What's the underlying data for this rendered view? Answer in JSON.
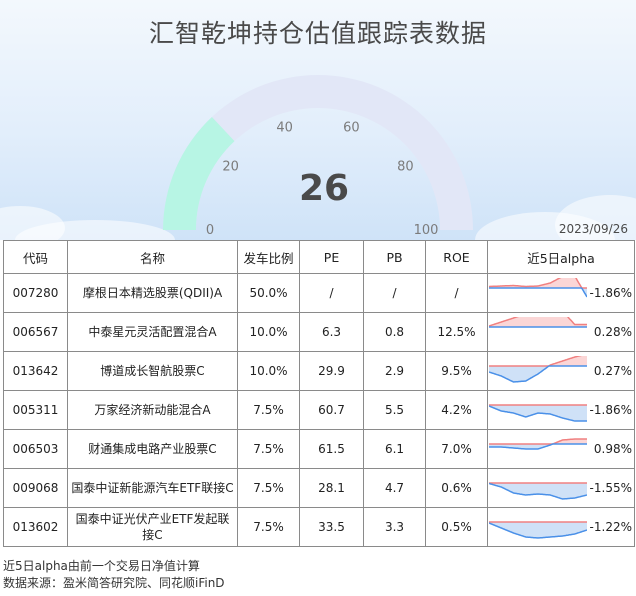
{
  "title": "汇智乾坤持仓估值跟踪表数据",
  "date": "2023/09/26",
  "colors": {
    "gauge_fill": "#b7f5e4",
    "gauge_track": "#e2e7f7",
    "positive": "#f08080",
    "negative": "#4a90e8"
  },
  "gauge": {
    "value": "26",
    "min": 0,
    "max": 100,
    "ticks": [
      "0",
      "20",
      "40",
      "60",
      "80",
      "100"
    ]
  },
  "table": {
    "headers": [
      "代码",
      "名称",
      "发车比例",
      "PE",
      "PB",
      "ROE",
      "近5日alpha"
    ],
    "rows": [
      {
        "code": "007280",
        "name": "摩根日本精选股票(QDII)A",
        "ratio": "50.0%",
        "pe": "/",
        "pb": "/",
        "roe": "/",
        "alpha": "-1.86%",
        "spark": [
          0.15,
          0.2,
          0.25,
          0.15,
          0.2,
          0.5,
          1.15,
          1.2,
          -0.9
        ]
      },
      {
        "code": "006567",
        "name": "中泰星元灵活配置混合A",
        "ratio": "10.0%",
        "pe": "6.3",
        "pb": "0.8",
        "roe": "12.5%",
        "alpha": "0.28%",
        "spark": [
          0.1,
          0.5,
          0.9,
          1.3,
          1.55,
          1.9,
          1.6,
          0.25,
          0.25
        ]
      },
      {
        "code": "013642",
        "name": "博道成长智航股票C",
        "ratio": "10.0%",
        "pe": "29.9",
        "pb": "2.9",
        "roe": "9.5%",
        "alpha": "0.27%",
        "spark": [
          -0.6,
          -1.0,
          -1.6,
          -1.5,
          -0.8,
          0.1,
          0.5,
          0.9,
          1.2
        ]
      },
      {
        "code": "005311",
        "name": "万家经济新动能混合A",
        "ratio": "7.5%",
        "pe": "60.7",
        "pb": "5.5",
        "roe": "4.2%",
        "alpha": "-1.86%",
        "spark": [
          -0.1,
          -0.6,
          -0.8,
          -1.2,
          -0.8,
          -0.9,
          -1.3,
          -1.6,
          -1.6
        ]
      },
      {
        "code": "006503",
        "name": "财通集成电路产业股票C",
        "ratio": "7.5%",
        "pe": "61.5",
        "pb": "6.1",
        "roe": "7.0%",
        "alpha": "0.98%",
        "spark": [
          -0.3,
          -0.3,
          -0.4,
          -0.5,
          -0.5,
          -0.1,
          0.4,
          0.5,
          0.5
        ]
      },
      {
        "code": "009068",
        "name": "国泰中证新能源汽车ETF联接C",
        "ratio": "7.5%",
        "pe": "28.1",
        "pb": "4.7",
        "roe": "0.6%",
        "alpha": "-1.55%",
        "spark": [
          -0.05,
          -0.4,
          -1.0,
          -1.2,
          -1.1,
          -1.2,
          -1.6,
          -1.5,
          -1.2
        ]
      },
      {
        "code": "013602",
        "name": "国泰中证光伏产业ETF发起联接C",
        "ratio": "7.5%",
        "pe": "33.5",
        "pb": "3.3",
        "roe": "0.5%",
        "alpha": "-1.22%",
        "spark": [
          -0.1,
          -0.6,
          -1.1,
          -1.5,
          -1.6,
          -1.5,
          -1.4,
          -1.2,
          -0.8
        ]
      }
    ]
  },
  "notes": [
    "近5日alpha由前一个交易日净值计算",
    "数据来源：盈米简答研究院、同花顺iFinD"
  ],
  "chart_data": [
    {
      "type": "gauge",
      "value": 26,
      "range": [
        0,
        100
      ],
      "tick_labels": [
        "0",
        "20",
        "40",
        "60",
        "80",
        "100"
      ]
    },
    {
      "type": "area",
      "title": "近5日alpha",
      "series": [
        {
          "name": "007280",
          "values": [
            0.15,
            0.2,
            0.25,
            0.15,
            0.2,
            0.5,
            1.15,
            1.2,
            -0.9
          ]
        },
        {
          "name": "006567",
          "values": [
            0.1,
            0.5,
            0.9,
            1.3,
            1.55,
            1.9,
            1.6,
            0.25,
            0.25
          ]
        },
        {
          "name": "013642",
          "values": [
            -0.6,
            -1.0,
            -1.6,
            -1.5,
            -0.8,
            0.1,
            0.5,
            0.9,
            1.2
          ]
        },
        {
          "name": "005311",
          "values": [
            -0.1,
            -0.6,
            -0.8,
            -1.2,
            -0.8,
            -0.9,
            -1.3,
            -1.6,
            -1.6
          ]
        },
        {
          "name": "006503",
          "values": [
            -0.3,
            -0.3,
            -0.4,
            -0.5,
            -0.5,
            -0.1,
            0.4,
            0.5,
            0.5
          ]
        },
        {
          "name": "009068",
          "values": [
            -0.05,
            -0.4,
            -1.0,
            -1.2,
            -1.1,
            -1.2,
            -1.6,
            -1.5,
            -1.2
          ]
        },
        {
          "name": "013602",
          "values": [
            -0.1,
            -0.6,
            -1.1,
            -1.5,
            -1.6,
            -1.5,
            -1.4,
            -1.2,
            -0.8
          ]
        }
      ]
    }
  ]
}
